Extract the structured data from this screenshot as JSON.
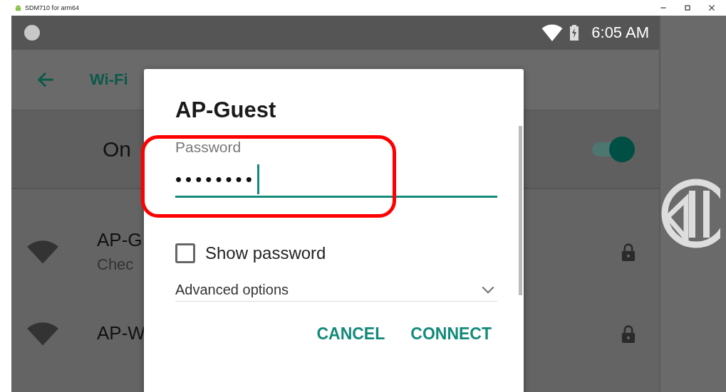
{
  "window": {
    "title": "SDM710 for arm64"
  },
  "status_bar": {
    "time": "6:05 AM"
  },
  "app_bar": {
    "title": "Wi-Fi"
  },
  "wifi": {
    "label": "On",
    "on": true
  },
  "networks": [
    {
      "name": "AP-G",
      "status": "Chec",
      "locked": true
    },
    {
      "name": "AP-W",
      "locked": true
    }
  ],
  "dialog": {
    "title": "AP-Guest",
    "password": {
      "label": "Password",
      "value": "••••••••"
    },
    "highlighted": true,
    "show_password": {
      "label": "Show password",
      "checked": false
    },
    "advanced": {
      "label": "Advanced options",
      "expanded": false
    },
    "buttons": [
      "CANCEL",
      "CONNECT"
    ]
  }
}
